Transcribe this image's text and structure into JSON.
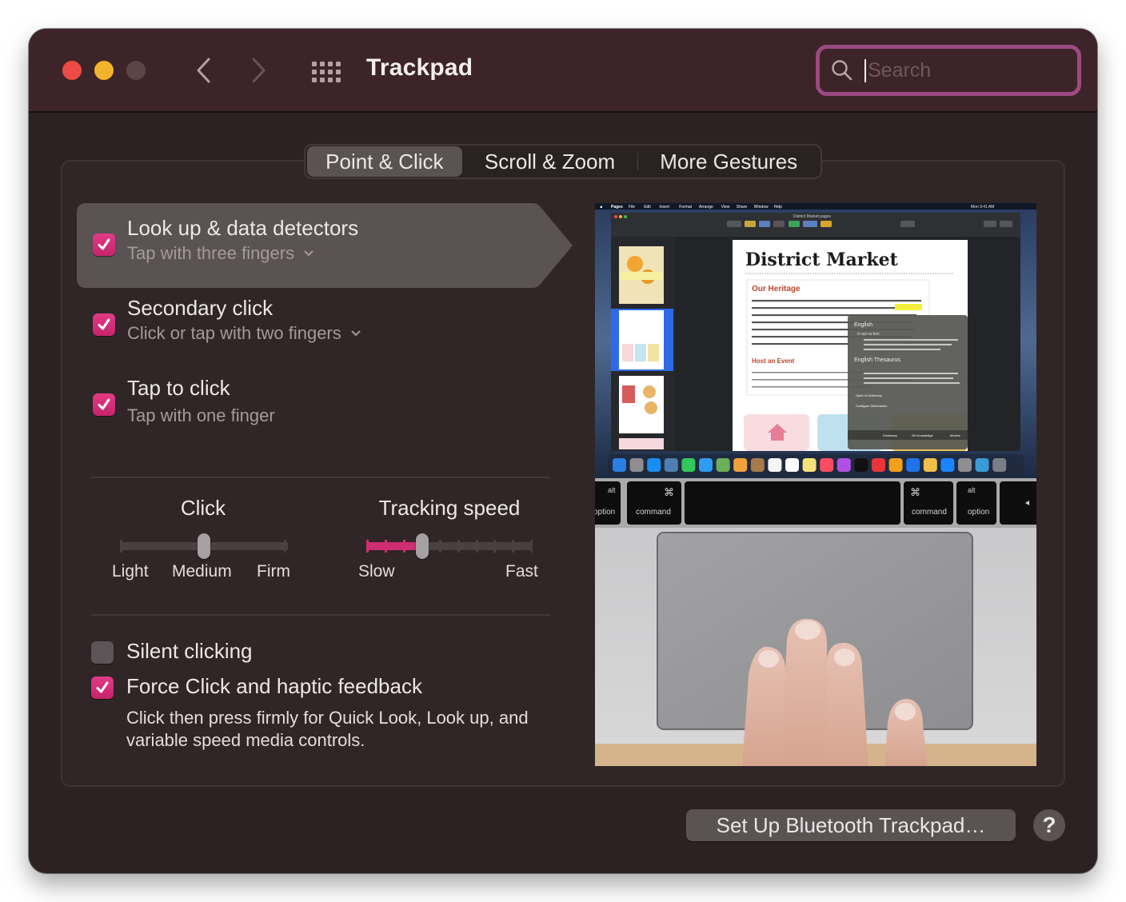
{
  "window": {
    "title": "Trackpad",
    "accent_color": "#d02e72",
    "search_ring_color": "#9c4a82"
  },
  "toolbar": {
    "back_icon": "chevron-left-icon",
    "forward_icon": "chevron-right-icon",
    "grid_icon": "show-all-grid-icon",
    "search": {
      "value": "",
      "placeholder": "Search"
    }
  },
  "tabs": [
    {
      "label": "Point & Click",
      "active": true
    },
    {
      "label": "Scroll & Zoom",
      "active": false
    },
    {
      "label": "More Gestures",
      "active": false
    }
  ],
  "gestures": [
    {
      "label": "Look up & data detectors",
      "sub": "Tap with three fingers",
      "has_menu": true,
      "checked": true,
      "selected": true
    },
    {
      "label": "Secondary click",
      "sub": "Click or tap with two fingers",
      "has_menu": true,
      "checked": true,
      "selected": false
    },
    {
      "label": "Tap to click",
      "sub": "Tap with one finger",
      "has_menu": false,
      "checked": true,
      "selected": false
    }
  ],
  "sliders": {
    "click": {
      "title": "Click",
      "labels": [
        "Light",
        "Medium",
        "Firm"
      ],
      "value_index": 1,
      "steps": 3
    },
    "tracking": {
      "title": "Tracking speed",
      "min_label": "Slow",
      "max_label": "Fast",
      "value_index": 3,
      "steps": 10
    }
  },
  "options": [
    {
      "label": "Silent clicking",
      "checked": false
    },
    {
      "label": "Force Click and haptic feedback",
      "checked": true
    }
  ],
  "force_click_description": "Click then press firmly for Quick Look, Look up, and variable speed media controls.",
  "preview": {
    "menubar": [
      "Pages",
      "File",
      "Edit",
      "Insert",
      "Format",
      "Arrange",
      "View",
      "Share",
      "Window",
      "Help"
    ],
    "clock": "Mon 9:41 AM",
    "doc_window_title": "District Market.pages",
    "doc_title": "District Market",
    "section1": "Our Heritage",
    "section2": "Host an Event",
    "popover_heading1": "English",
    "popover_heading2": "English Thesaurus",
    "popover_word": "in·spi·ra·tion",
    "popover_items": [
      "Open in Dictionary",
      "Configure Dictionaries"
    ],
    "popover_tabs": [
      "Dictionary",
      "Siri Knowledge",
      "Movies"
    ],
    "keys": [
      "option",
      "command",
      "command",
      "option"
    ],
    "key_alt": "alt",
    "key_cmd": "⌘"
  },
  "footer": {
    "setup_button": "Set Up Bluetooth Trackpad…",
    "help_button": "?"
  }
}
